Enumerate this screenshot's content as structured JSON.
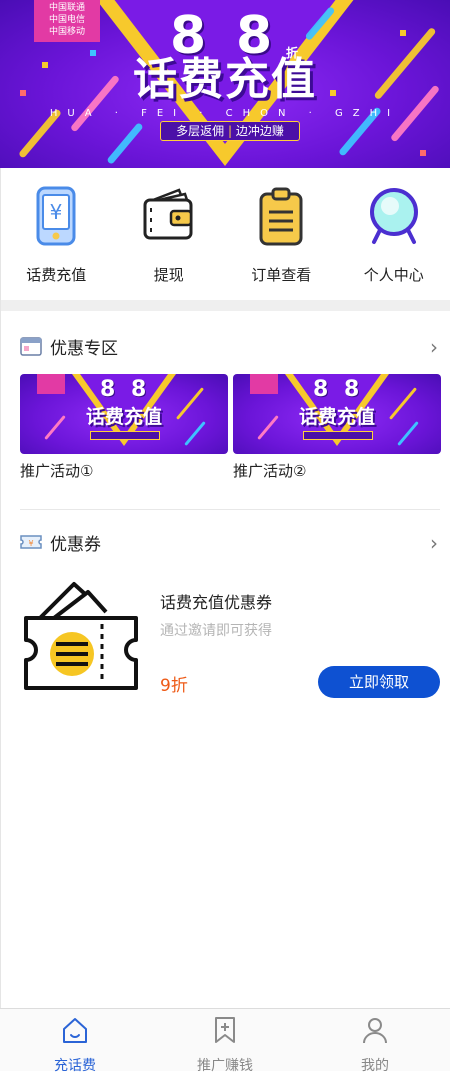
{
  "banner": {
    "operators": [
      "中国联通",
      "中国电信",
      "中国移动"
    ],
    "discount_digit_1": "8",
    "discount_digit_2": "8",
    "discount_unit": "折",
    "title": "话费充值",
    "pinyin": "HUA · FEI · CHON · GZHI",
    "slogan_left": "多层返佣",
    "slogan_sep": "|",
    "slogan_right": "边冲边赚",
    "colors": {
      "purple": "#6b15d8",
      "yellow": "#f7c92c",
      "pink": "#e23aa4"
    }
  },
  "actions": [
    {
      "label": "话费充值",
      "icon": "phone-yuan-icon"
    },
    {
      "label": "提现",
      "icon": "wallet-icon"
    },
    {
      "label": "订单查看",
      "icon": "clipboard-icon"
    },
    {
      "label": "个人中心",
      "icon": "user-circle-icon"
    }
  ],
  "promotions": {
    "title": "优惠专区",
    "icon": "calendar-icon",
    "more_icon": "chevron-right-icon",
    "items": [
      {
        "caption": "推广活动①",
        "mini_title": "话费充值",
        "mini_digits": "8 8"
      },
      {
        "caption": "推广活动②",
        "mini_title": "话费充值",
        "mini_digits": "8 8"
      }
    ]
  },
  "coupons": {
    "title": "优惠券",
    "icon": "ticket-icon",
    "more_icon": "chevron-right-icon",
    "item": {
      "name": "话费充值优惠券",
      "desc": "通过邀请即可获得",
      "price": "9折",
      "button": "立即领取",
      "accent": "#0e51d2",
      "price_color": "#ee5a16"
    }
  },
  "nav": [
    {
      "label": "充话费",
      "icon": "home-icon",
      "active": true
    },
    {
      "label": "推广赚钱",
      "icon": "bookmark-plus-icon",
      "active": false
    },
    {
      "label": "我的",
      "icon": "user-icon",
      "active": false
    }
  ]
}
